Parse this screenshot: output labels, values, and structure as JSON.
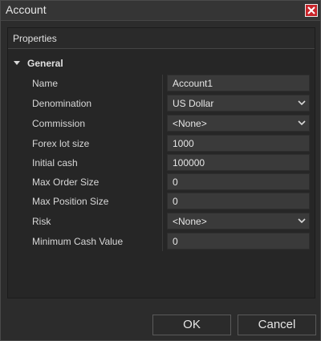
{
  "window": {
    "title": "Account"
  },
  "panel": {
    "header": "Properties"
  },
  "group": {
    "label": "General"
  },
  "properties": [
    {
      "label": "Name",
      "value": "Account1",
      "type": "text"
    },
    {
      "label": "Denomination",
      "value": "US Dollar",
      "type": "dropdown"
    },
    {
      "label": "Commission",
      "value": "<None>",
      "type": "dropdown"
    },
    {
      "label": "Forex lot size",
      "value": "1000",
      "type": "text"
    },
    {
      "label": "Initial cash",
      "value": "100000",
      "type": "text"
    },
    {
      "label": "Max Order Size",
      "value": "0",
      "type": "text"
    },
    {
      "label": "Max Position Size",
      "value": "0",
      "type": "text"
    },
    {
      "label": "Risk",
      "value": "<None>",
      "type": "dropdown"
    },
    {
      "label": "Minimum Cash Value",
      "value": "0",
      "type": "text"
    }
  ],
  "buttons": {
    "ok": "OK",
    "cancel": "Cancel"
  },
  "icons": {
    "close": "close-icon",
    "expand": "triangle-down-icon",
    "dropdown": "chevron-down-icon"
  },
  "colors": {
    "background": "#2b2b2b",
    "close": "#c8242a"
  }
}
